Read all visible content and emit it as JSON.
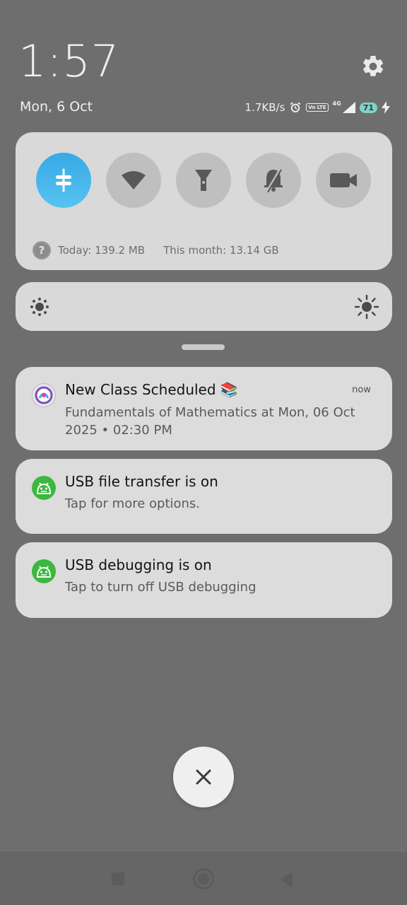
{
  "header": {
    "time": "1:57",
    "date": "Mon, 6 Oct",
    "settings_icon": "gear-icon"
  },
  "status_bar": {
    "net_speed": "1.7KB/s",
    "alarm_icon": "alarm-icon",
    "volte": "Vo LTE",
    "network": "4G",
    "signal_icon": "signal-icon",
    "battery": "71",
    "charging_icon": "lightning-icon"
  },
  "quick_settings": {
    "toggles": [
      {
        "name": "mobile-data",
        "icon": "data-transfer-icon",
        "active": true
      },
      {
        "name": "wifi",
        "icon": "wifi-icon",
        "active": false
      },
      {
        "name": "flashlight",
        "icon": "flashlight-icon",
        "active": false
      },
      {
        "name": "mute",
        "icon": "bell-off-icon",
        "active": false
      },
      {
        "name": "screen-recorder",
        "icon": "video-camera-icon",
        "active": false
      }
    ],
    "data_usage": {
      "help_glyph": "?",
      "today": "Today: 139.2 MB",
      "month": "This month: 13.14 GB"
    }
  },
  "brightness": {
    "low_icon": "sun-low-icon",
    "high_icon": "sun-high-icon"
  },
  "notifications": [
    {
      "app_icon": "class-app-icon",
      "title": "New Class Scheduled 📚",
      "body": "Fundamentals of Mathematics at Mon, 06 Oct 2025 • 02:30 PM",
      "time": "now"
    },
    {
      "app_icon": "android-icon",
      "title": "USB file transfer is on",
      "body": "Tap for more options."
    },
    {
      "app_icon": "android-icon",
      "title": "USB debugging is on",
      "body": "Tap to turn off USB debugging"
    }
  ],
  "controls": {
    "clear_icon": "close-icon"
  },
  "colors": {
    "background": "#6e6e6e",
    "card": "#d9d9d9",
    "accent": "#42b0ea",
    "android_green": "#3cb83f"
  }
}
